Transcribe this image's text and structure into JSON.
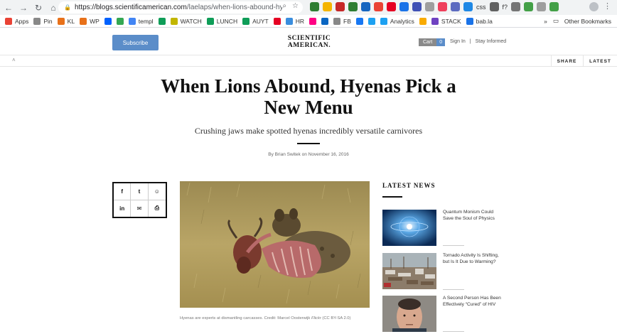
{
  "browser": {
    "url_host": "https://blogs.scientificamerican.com",
    "url_path": "/laelaps/when-lions-abound-hy...",
    "bookmarks": [
      {
        "label": "Apps",
        "icon": "apps-grid-icon",
        "color": "#e94235"
      },
      {
        "label": "Pin",
        "icon": "page-icon",
        "color": "#888888"
      },
      {
        "label": "KL",
        "icon": "kl-icon",
        "color": "#e8711a"
      },
      {
        "label": "WP",
        "icon": "wordpress-icon",
        "color": "#e8711a"
      },
      {
        "label": "",
        "icon": "dropbox-icon",
        "color": "#0061fe"
      },
      {
        "label": "",
        "icon": "drive-icon",
        "color": "#34a853"
      },
      {
        "label": "templ",
        "icon": "docs-icon",
        "color": "#4285f4"
      },
      {
        "label": "",
        "icon": "sheets-icon",
        "color": "#0f9d58"
      },
      {
        "label": "WATCH",
        "icon": "star-icon",
        "color": "#c2b600"
      },
      {
        "label": "LUNCH",
        "icon": "sheets-icon",
        "color": "#0f9d58"
      },
      {
        "label": "AUYT",
        "icon": "sheets-icon",
        "color": "#0f9d58"
      },
      {
        "label": "",
        "icon": "pinterest-icon",
        "color": "#e60023"
      },
      {
        "label": "HR",
        "icon": "cloud-icon",
        "color": "#3a8dde"
      },
      {
        "label": "",
        "icon": "flickr-icon",
        "color": "#ff0084"
      },
      {
        "label": "",
        "icon": "linkedin-icon",
        "color": "#0a66c2"
      },
      {
        "label": "FB",
        "icon": "page-icon",
        "color": "#888888"
      },
      {
        "label": "",
        "icon": "facebook-icon",
        "color": "#1877f2"
      },
      {
        "label": "",
        "icon": "twitter-icon",
        "color": "#1da1f2"
      },
      {
        "label": "Analytics",
        "icon": "twitter-icon",
        "color": "#1da1f2"
      },
      {
        "label": "",
        "icon": "analytics-icon",
        "color": "#f9ab00"
      },
      {
        "label": "STACK",
        "icon": "stack-icon",
        "color": "#6f42c1"
      },
      {
        "label": "bab.la",
        "icon": "chat-icon",
        "color": "#1a73e8"
      }
    ],
    "overflow": "»",
    "other_bookmarks": "Other Bookmarks",
    "ext_labels": {
      "css": "css",
      "fx": "f?"
    }
  },
  "header": {
    "subscribe": "Subscribe",
    "logo_line1": "SCIENTIFIC",
    "logo_line2": "AMERICAN.",
    "cart_label": "Cart",
    "cart_count": "0",
    "sign_in": "Sign In",
    "separator": "|",
    "stay_informed": "Stay Informed",
    "share": "SHARE",
    "latest": "LATEST"
  },
  "article": {
    "headline": "When Lions Abound, Hyenas Pick a New Menu",
    "dek": "Crushing jaws make spotted hyenas incredibly versatile carnivores",
    "byline": "By Brian Switek on November 16, 2016",
    "caption_text": "Hyenas are experts at dismantling carcasses. Credit: Marcel Oosterwijk ",
    "caption_source": "Flickr",
    "caption_license": " (CC BY-SA 2.0)"
  },
  "share_buttons": [
    {
      "name": "facebook-share-button",
      "glyph": "f"
    },
    {
      "name": "twitter-share-button",
      "glyph": "t"
    },
    {
      "name": "reddit-share-button",
      "glyph": "☺"
    },
    {
      "name": "linkedin-share-button",
      "glyph": "in"
    },
    {
      "name": "email-share-button",
      "glyph": "✉"
    },
    {
      "name": "print-share-button",
      "glyph": "⎙"
    }
  ],
  "sidebar": {
    "title": "LATEST NEWS",
    "items": [
      {
        "title": "Quantum Monism Could Save the Soul of Physics"
      },
      {
        "title": "Tornado Activity Is Shifting, but Is It Due to Warming?"
      },
      {
        "title": "A Second Person Has Been Effectively “Cured” of HIV"
      }
    ]
  },
  "colors": {
    "subscribe_blue": "#5b8dc9",
    "cart_gray": "#8a8a8a"
  }
}
